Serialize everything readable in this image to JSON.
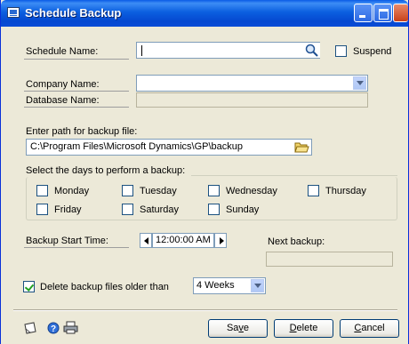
{
  "window": {
    "title": "Schedule Backup"
  },
  "schedule": {
    "label": "Schedule Name:",
    "value": "",
    "suspend_label": "Suspend",
    "suspend_checked": false
  },
  "company": {
    "label": "Company Name:",
    "value": ""
  },
  "database": {
    "label": "Database Name:",
    "value": ""
  },
  "path": {
    "label": "Enter path for backup file:",
    "value": "C:\\Program Files\\Microsoft Dynamics\\GP\\backup"
  },
  "days": {
    "label": "Select the days to perform a backup:",
    "items": [
      {
        "label": "Monday",
        "checked": false
      },
      {
        "label": "Tuesday",
        "checked": false
      },
      {
        "label": "Wednesday",
        "checked": false
      },
      {
        "label": "Thursday",
        "checked": false
      },
      {
        "label": "Friday",
        "checked": false
      },
      {
        "label": "Saturday",
        "checked": false
      },
      {
        "label": "Sunday",
        "checked": false
      }
    ]
  },
  "start_time": {
    "label": "Backup Start Time:",
    "value": "12:00:00 AM"
  },
  "next_backup": {
    "label": "Next backup:",
    "value": ""
  },
  "delete_old": {
    "label": "Delete backup files older than",
    "checked": true,
    "selected": "4 Weeks"
  },
  "buttons": {
    "save": {
      "pre": "Sa",
      "ak": "v",
      "post": "e"
    },
    "delete": {
      "pre": "",
      "ak": "D",
      "post": "elete"
    },
    "cancel": {
      "pre": "",
      "ak": "C",
      "post": "ancel"
    }
  },
  "icons": [
    "note-icon",
    "help-icon",
    "print-icon"
  ]
}
